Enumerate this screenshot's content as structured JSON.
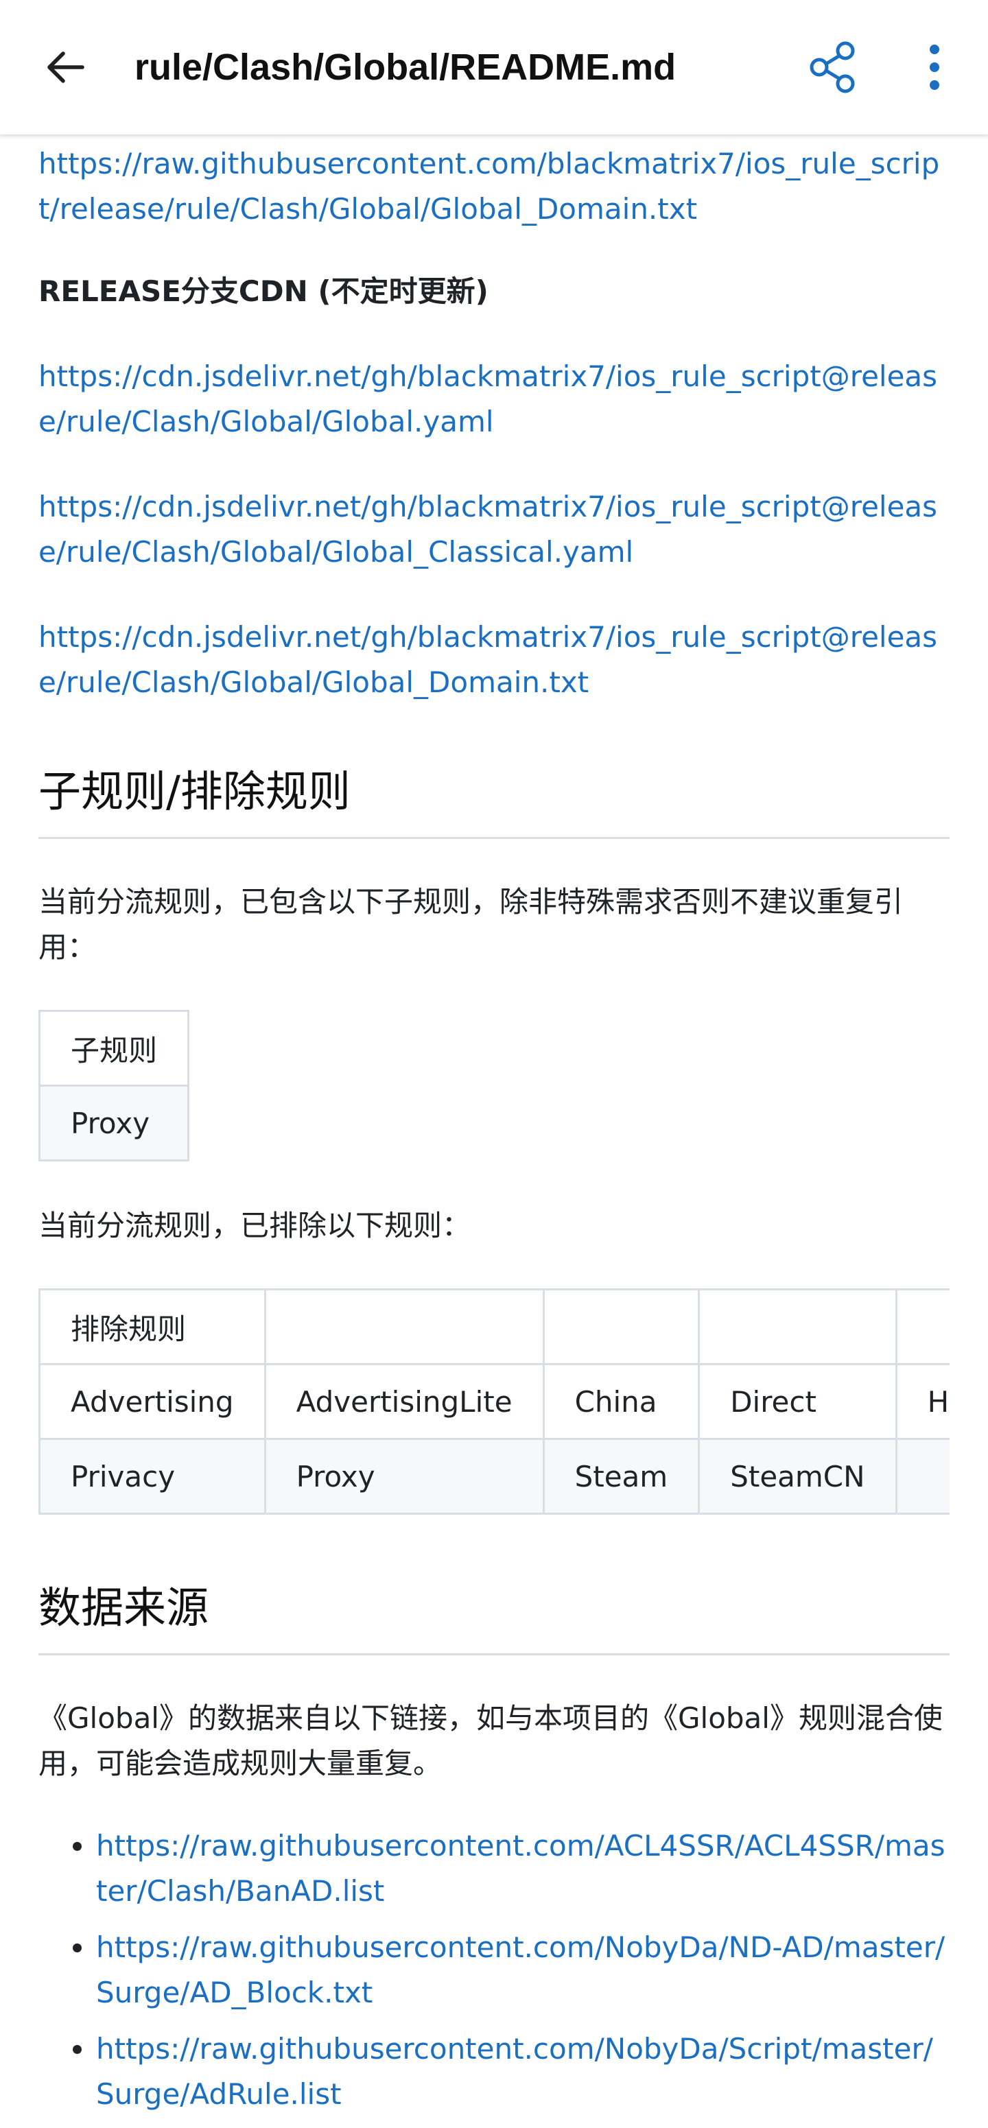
{
  "appbar": {
    "title": "rule/Clash/Global/README.md",
    "back_icon": "arrow-back-icon",
    "share_icon": "share-icon",
    "more_icon": "more-vert-icon",
    "accent_color": "#1a6fc2"
  },
  "top_link": "https://raw.githubusercontent.com/blackmatrix7/ios_rule_script/release/rule/Clash/Global/Global_Domain.txt",
  "release_cdn_label": "RELEASE分支CDN (不定时更新)",
  "cdn_links": [
    "https://cdn.jsdelivr.net/gh/blackmatrix7/ios_rule_script@release/rule/Clash/Global/Global.yaml",
    "https://cdn.jsdelivr.net/gh/blackmatrix7/ios_rule_script@release/rule/Clash/Global/Global_Classical.yaml",
    "https://cdn.jsdelivr.net/gh/blackmatrix7/ios_rule_script@release/rule/Clash/Global/Global_Domain.txt"
  ],
  "sub_rules_section": {
    "heading": "子规则/排除规则",
    "intro": "当前分流规则，已包含以下子规则，除非特殊需求否则不建议重复引用：",
    "table_header": "子规则",
    "table_rows": [
      "Proxy"
    ],
    "exclude_intro": "当前分流规则，已排除以下规则：",
    "exclude_header": "排除规则",
    "exclude_rows": [
      [
        "Advertising",
        "AdvertisingLite",
        "China",
        "Direct",
        "H"
      ],
      [
        "Privacy",
        "Proxy",
        "Steam",
        "SteamCN",
        ""
      ]
    ]
  },
  "data_source_section": {
    "heading": "数据来源",
    "intro": "《Global》的数据来自以下链接，如与本项目的《Global》规则混合使用，可能会造成规则大量重复。",
    "links": [
      "https://raw.githubusercontent.com/ACL4SSR/ACL4SSR/master/Clash/BanAD.list",
      "https://raw.githubusercontent.com/NobyDa/ND-AD/master/Surge/AD_Block.txt",
      "https://raw.githubusercontent.com/NobyDa/Script/master/Surge/AdRule.list"
    ]
  }
}
